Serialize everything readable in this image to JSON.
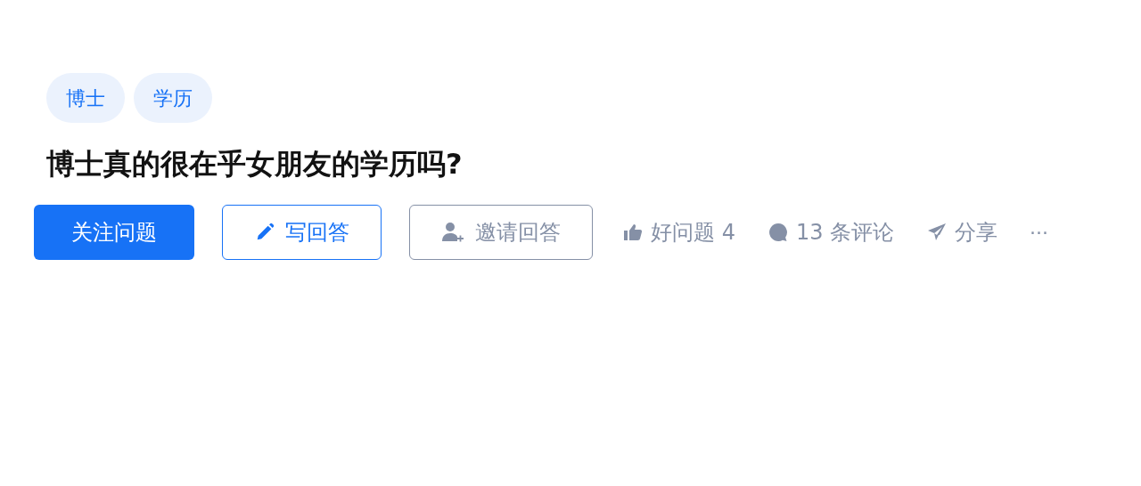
{
  "tags": [
    "博士",
    "学历"
  ],
  "title": "博士真的很在乎女朋友的学历吗?",
  "buttons": [
    {
      "kind": "primary",
      "label": "关注问题"
    },
    {
      "kind": "write",
      "label": "写回答"
    },
    {
      "kind": "invite",
      "label": "邀请回答"
    }
  ],
  "actions": [
    {
      "kind": "like",
      "label": "好问题 4"
    },
    {
      "kind": "comment",
      "label": "13 条评论"
    },
    {
      "kind": "share",
      "label": "分享"
    },
    {
      "kind": "more",
      "label": "···"
    }
  ]
}
